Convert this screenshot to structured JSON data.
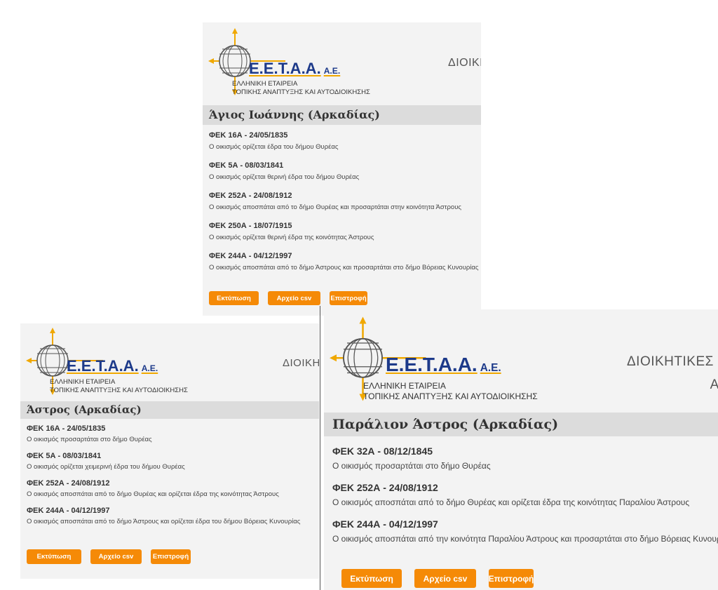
{
  "logo": {
    "brand": "E.E.T.A.A.",
    "suffix": "A.E.",
    "line1": "ΕΛΛΗΝΙΚΗ ΕΤΑΙΡΕΙΑ",
    "line2": "ΤΟΠΙΚΗΣ ΑΝΑΠΤΥΞΗΣ ΚΑΙ ΑΥΤΟΔΙΟΙΚΗΣΗΣ"
  },
  "colors": {
    "button": "#f58a07",
    "brand": "#1d3a8a",
    "accent": "#f0a800",
    "title_bg": "#dcdcdc",
    "panel_bg": "#f3f3f3"
  },
  "panel1": {
    "header": "ΔΙΟΙΚΗ",
    "place": "Άγιος Ιωάννης (Αρκαδίας)",
    "entries": [
      {
        "title": "ΦΕΚ 16Α - 24/05/1835",
        "desc": "Ο οικισμός ορίζεται έδρα του δήμου Θυρέας"
      },
      {
        "title": "ΦΕΚ 5Α - 08/03/1841",
        "desc": "Ο οικισμός ορίζεται θερινή έδρα του δήμου Θυρέας"
      },
      {
        "title": "ΦΕΚ 252Α - 24/08/1912",
        "desc": "Ο οικισμός αποσπάται από το δήμο Θυρέας και προσαρτάται στην κοινότητα Άστρους"
      },
      {
        "title": "ΦΕΚ 250Α - 18/07/1915",
        "desc": "Ο οικισμός ορίζεται θερινή έδρα της κοινότητας Άστρους"
      },
      {
        "title": "ΦΕΚ 244Α - 04/12/1997",
        "desc": "Ο οικισμός αποσπάται από το δήμο Άστρους και προσαρτάται στο δήμο Βόρειας Κυνουρίας"
      }
    ],
    "buttons": {
      "print": "Εκτύπωση",
      "csv": "Αρχείο csv",
      "back": "Επιστροφή"
    }
  },
  "panel2": {
    "header": "ΔΙΟΙΚΗ",
    "place": "Άστρος (Αρκαδίας)",
    "entries": [
      {
        "title": "ΦΕΚ 16Α - 24/05/1835",
        "desc": "Ο οικισμός προσαρτάται στο δήμο Θυρέας"
      },
      {
        "title": "ΦΕΚ 5Α - 08/03/1841",
        "desc": "Ο οικισμός ορίζεται χειμερινή έδρα του δήμου Θυρέας"
      },
      {
        "title": "ΦΕΚ 252Α - 24/08/1912",
        "desc": "Ο οικισμός αποσπάται από το δήμο Θυρέας και ορίζεται έδρα της κοινότητας Άστρους"
      },
      {
        "title": "ΦΕΚ 244Α - 04/12/1997",
        "desc": "Ο οικισμός αποσπάται από το δήμο Άστρους και ορίζεται έδρα του δήμου Βόρειας Κυνουρίας"
      }
    ],
    "buttons": {
      "print": "Εκτύπωση",
      "csv": "Αρχείο csv",
      "back": "Επιστροφή"
    }
  },
  "panel3": {
    "header_line1": "ΔΙΟΙΚΗΤΙΚΕΣ Μ",
    "header_line2": "ΑΝ",
    "place": "Παράλιον Άστρος (Αρκαδίας)",
    "entries": [
      {
        "title": "ΦΕΚ 32Α - 08/12/1845",
        "desc": "Ο οικισμός προσαρτάται στο δήμο Θυρέας"
      },
      {
        "title": "ΦΕΚ 252Α - 24/08/1912",
        "desc": "Ο οικισμός αποσπάται από το δήμο Θυρέας και ορίζεται έδρα της κοινότητας Παραλίου Άστρους"
      },
      {
        "title": "ΦΕΚ 244Α - 04/12/1997",
        "desc": "Ο οικισμός αποσπάται από την κοινότητα Παραλίου Άστρους και προσαρτάται στο δήμο Βόρειας Κυνουρίας"
      }
    ],
    "buttons": {
      "print": "Εκτύπωση",
      "csv": "Αρχείο csv",
      "back": "Επιστροφή"
    }
  }
}
